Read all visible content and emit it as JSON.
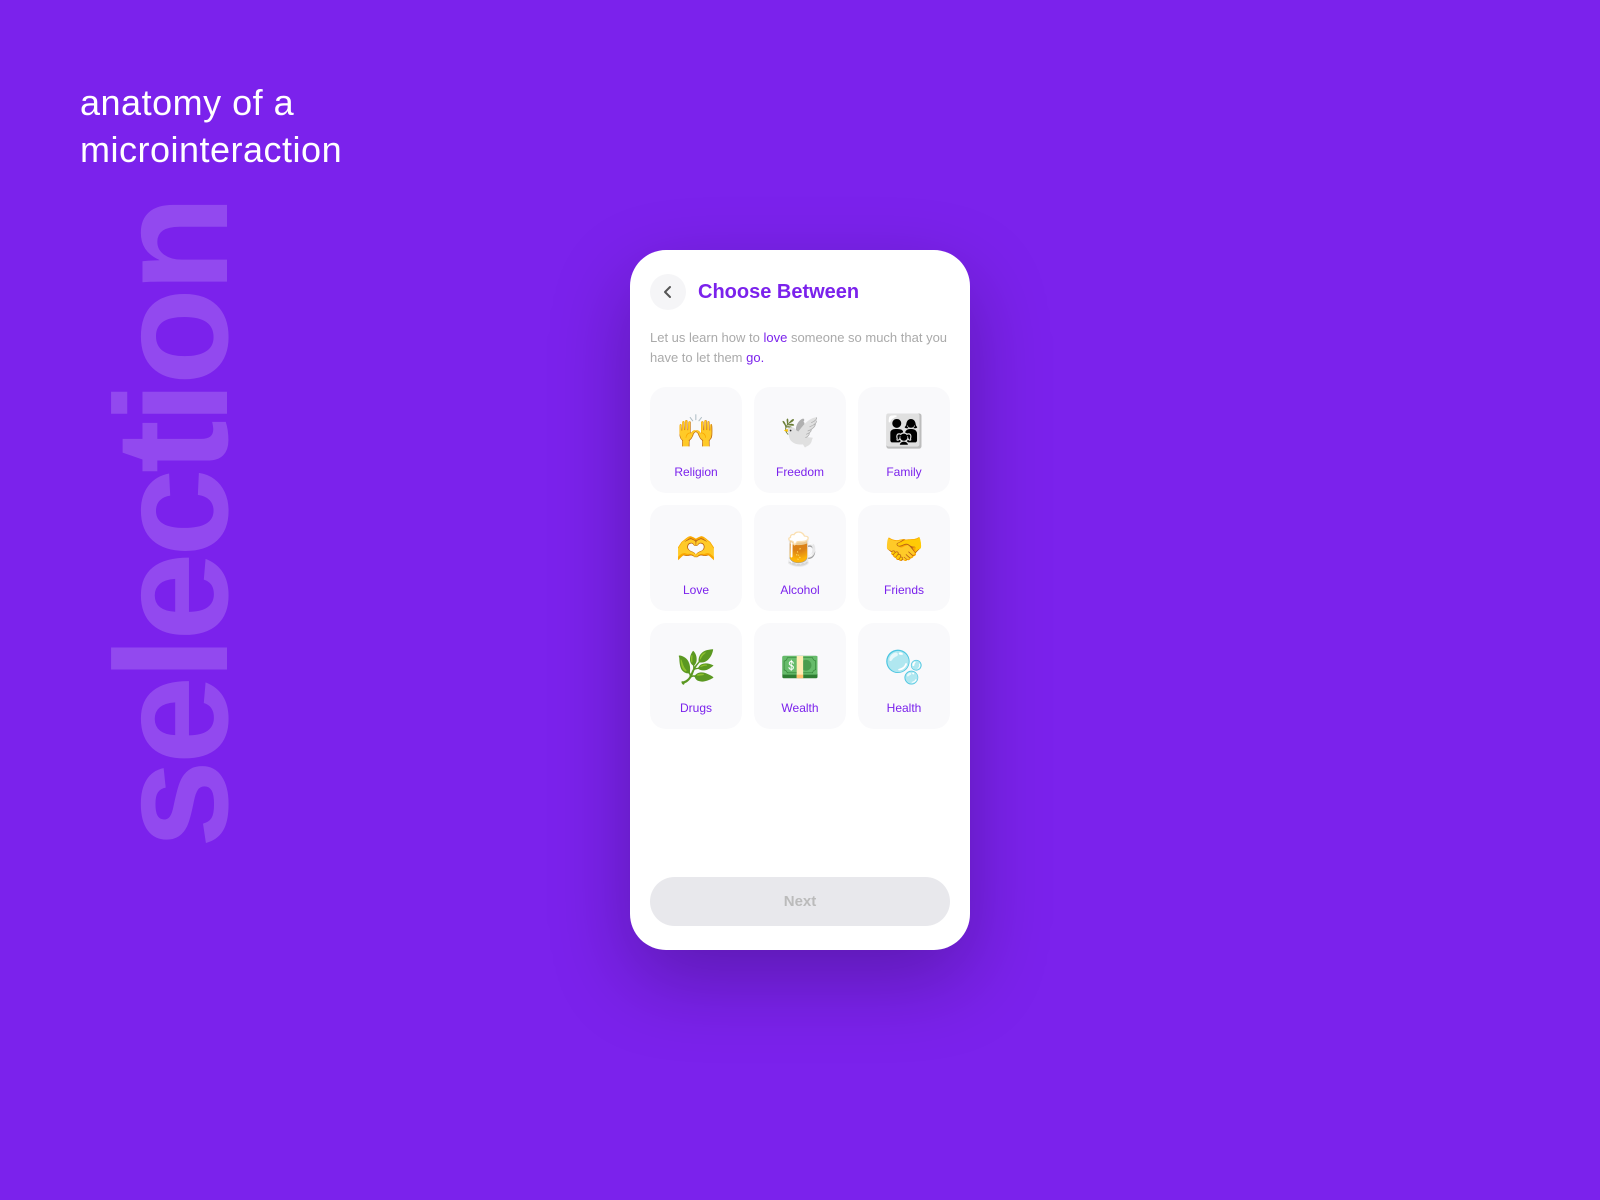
{
  "background": {
    "color": "#7B22EC",
    "heading_line1": "anatomy of a",
    "heading_line2": "microinteraction",
    "watermark": "selection"
  },
  "phone": {
    "back_button_label": "‹",
    "title": "Choose Between",
    "subtitle_text": "Let us learn how to love someone so much that you have to let them go.",
    "subtitle_love": "love",
    "subtitle_go": "go.",
    "cards": [
      {
        "id": "religion",
        "label": "Religion",
        "icon": "🙌"
      },
      {
        "id": "freedom",
        "label": "Freedom",
        "icon": "🕊️"
      },
      {
        "id": "family",
        "label": "Family",
        "icon": "👨‍👩‍👧"
      },
      {
        "id": "love",
        "label": "Love",
        "icon": "🫶"
      },
      {
        "id": "alcohol",
        "label": "Alcohol",
        "icon": "🍺"
      },
      {
        "id": "friends",
        "label": "Friends",
        "icon": "🤝"
      },
      {
        "id": "drugs",
        "label": "Drugs",
        "icon": "🌿"
      },
      {
        "id": "wealth",
        "label": "Wealth",
        "icon": "💵"
      },
      {
        "id": "health",
        "label": "Health",
        "icon": "🫧"
      }
    ],
    "next_button_label": "Next"
  }
}
